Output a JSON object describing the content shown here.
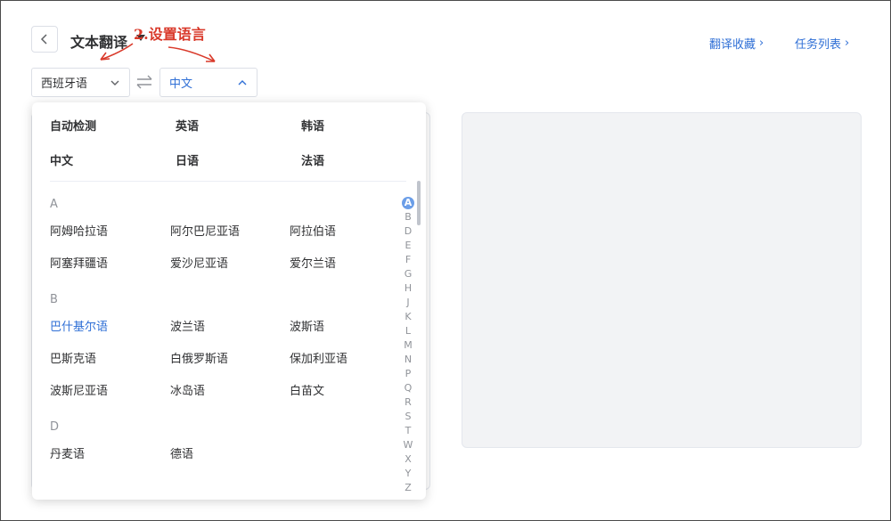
{
  "header": {
    "title": "文本翻译",
    "annotation": "2.设置语言",
    "links": [
      {
        "label": "翻译收藏",
        "chevron": "›"
      },
      {
        "label": "任务列表",
        "chevron": "›"
      }
    ]
  },
  "source_lang": {
    "value": "西班牙语"
  },
  "target_lang": {
    "value": "中文"
  },
  "dropdown": {
    "common": [
      "自动检测",
      "英语",
      "韩语",
      "中文",
      "日语",
      "法语"
    ],
    "groups": [
      {
        "letter": "A",
        "items": [
          "阿姆哈拉语",
          "阿尔巴尼亚语",
          "阿拉伯语",
          "阿塞拜疆语",
          "爱沙尼亚语",
          "爱尔兰语"
        ]
      },
      {
        "letter": "B",
        "items": [
          "巴什基尔语",
          "波兰语",
          "波斯语",
          "巴斯克语",
          "白俄罗斯语",
          "保加利亚语",
          "波斯尼亚语",
          "冰岛语",
          "白苗文"
        ]
      },
      {
        "letter": "D",
        "items": [
          "丹麦语",
          "德语"
        ]
      }
    ],
    "active_item": "巴什基尔语",
    "index": [
      "A",
      "B",
      "D",
      "E",
      "F",
      "G",
      "H",
      "J",
      "K",
      "L",
      "M",
      "N",
      "P",
      "Q",
      "R",
      "S",
      "T",
      "W",
      "X",
      "Y",
      "Z"
    ],
    "active_index": "A"
  },
  "colors": {
    "accent": "#2f6fd6",
    "annotation": "#d9392a",
    "panel_bg": "#f2f3f5"
  }
}
